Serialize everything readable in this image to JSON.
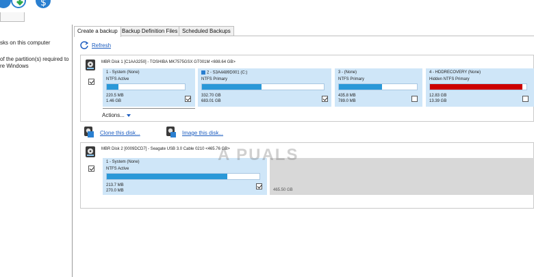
{
  "left_panel": {
    "line1": "sks on this computer",
    "line2": "of the partition(s) required to",
    "line3": "re Windows"
  },
  "tabs": [
    {
      "label": "Create a backup",
      "active": true
    },
    {
      "label": "Backup Definition Files",
      "active": false
    },
    {
      "label": "Scheduled Backups",
      "active": false
    }
  ],
  "refresh_label": "Refresh",
  "disk1": {
    "title": "MBR Disk 1 [C1AA3250] - TOSHIBA MK7575GSX GT001M  <698.64 GB>",
    "checked": true,
    "partitions": [
      {
        "name": "1 - System (None)",
        "type": "NTFS Active",
        "used": "220.5 MB",
        "total": "1.46 GB",
        "fill": 0.15,
        "checked": true,
        "color": "#2a98d8"
      },
      {
        "name": "2 - S3A4489D001 (C:)",
        "type": "NTFS Primary",
        "used": "332.70 GB",
        "total": "683.01 GB",
        "fill": 0.49,
        "checked": true,
        "color": "#2a98d8"
      },
      {
        "name": "3 -  (None)",
        "type": "NTFS Primary",
        "used": "435.8 MB",
        "total": "789.0 MB",
        "fill": 0.55,
        "checked": false,
        "color": "#2a98d8"
      },
      {
        "name": "4 - HDDRECOVERY (None)",
        "type": "Hidden NTFS Primary",
        "used": "12.83 GB",
        "total": "13.39 GB",
        "fill": 0.96,
        "checked": false,
        "color": "#cc0000"
      }
    ],
    "actions_label": "Actions..."
  },
  "clone_label": "Clone this disk...",
  "image_label": "Image this disk...",
  "disk2": {
    "title": "MBR Disk 2 [0009DCD7] - Seagate  USB 3.0 Cable    0210  <465.76 GB>",
    "checked": true,
    "partitions": [
      {
        "name": "1 - System (None)",
        "type": "NTFS Active",
        "used": "213.7 MB",
        "total": "270.0 MB",
        "fill": 0.79,
        "checked": true,
        "color": "#2a98d8"
      }
    ],
    "unallocated": "465.50 GB"
  },
  "watermark": "A PUALS"
}
